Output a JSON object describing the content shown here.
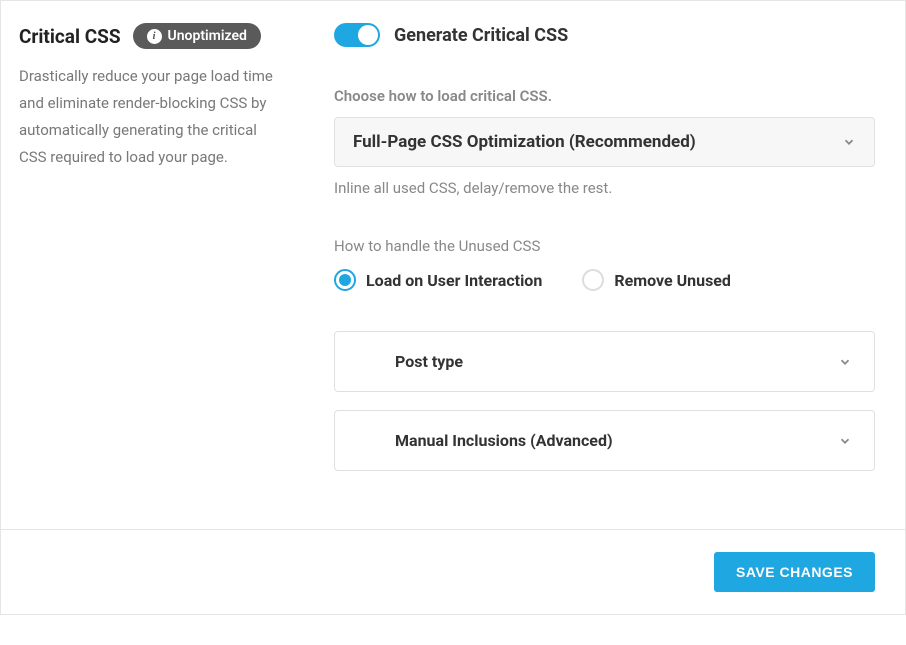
{
  "sidebar": {
    "title": "Critical CSS",
    "badge": "Unoptimized",
    "description": "Drastically reduce your page load time and eliminate render-blocking CSS by automatically generating the critical CSS required to load your page."
  },
  "main": {
    "toggle_label": "Generate Critical CSS",
    "load_section": {
      "label": "Choose how to load critical CSS.",
      "selected": "Full-Page CSS Optimization (Recommended)",
      "helper": "Inline all used CSS, delay/remove the rest."
    },
    "unused_section": {
      "label": "How to handle the Unused CSS",
      "options": [
        {
          "label": "Load on User Interaction",
          "checked": true
        },
        {
          "label": "Remove Unused",
          "checked": false
        }
      ]
    },
    "accordions": [
      {
        "title": "Post type"
      },
      {
        "title": "Manual Inclusions (Advanced)"
      }
    ]
  },
  "footer": {
    "save_label": "SAVE CHANGES"
  }
}
